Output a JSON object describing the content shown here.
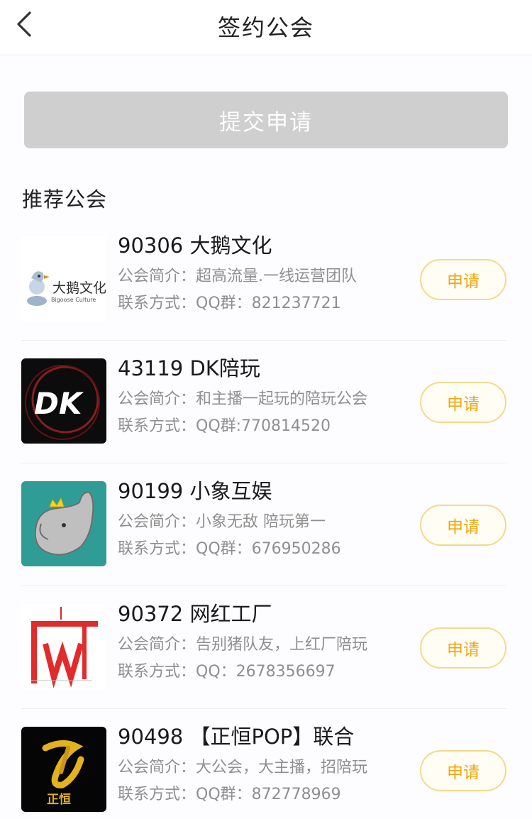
{
  "header": {
    "title": "签约公会",
    "back_icon": "chevron-left-icon"
  },
  "submit_label": "提交申请",
  "section_title": "推荐公会",
  "guilds": [
    {
      "name": "90306 大鹅文化",
      "desc": "公会简介：超高流量.一线运营团队",
      "contact": "联系方式：QQ群：821237721",
      "apply_label": "申请",
      "logo": {
        "icon": "goose-logo",
        "text": "大鹅文化",
        "subtext": "Bigoose Culture"
      }
    },
    {
      "name": "43119 DK陪玩",
      "desc": "公会简介：和主播一起玩的陪玩公会",
      "contact": "联系方式：QQ群:770814520",
      "apply_label": "申请",
      "logo": {
        "icon": "dk-logo",
        "text": "DK"
      }
    },
    {
      "name": "90199 小象互娱",
      "desc": "公会简介：小象无敌 陪玩第一",
      "contact": "联系方式：QQ群：676950286",
      "apply_label": "申请",
      "logo": {
        "icon": "elephant-logo"
      }
    },
    {
      "name": "90372 网红工厂",
      "desc": "公会简介：告别猪队友，上红厂陪玩",
      "contact": "联系方式：QQ：2678356697",
      "apply_label": "申请",
      "logo": {
        "icon": "wanghong-factory-logo"
      }
    },
    {
      "name": "90498 【正恒POP】联合",
      "desc": "公会简介：大公会，大主播，招陪玩",
      "contact": "联系方式：QQ群：872778969",
      "apply_label": "申请",
      "logo": {
        "icon": "zhengheng-logo",
        "text": "正恒"
      }
    }
  ],
  "colors": {
    "accent": "#efa70e",
    "apply_border": "#f4da8a",
    "submit_disabled": "#cfcfcf",
    "secondary_text": "#8f8f8f"
  }
}
